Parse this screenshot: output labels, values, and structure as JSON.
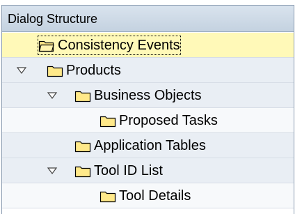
{
  "header": {
    "title": "Dialog Structure"
  },
  "tree": {
    "items": [
      {
        "label": "Consistency Events",
        "level": 1,
        "expandable": false,
        "selected": true
      },
      {
        "label": "Products",
        "level": 1,
        "expandable": true,
        "expanded": true
      },
      {
        "label": "Business Objects",
        "level": 2,
        "expandable": true,
        "expanded": true
      },
      {
        "label": "Proposed Tasks",
        "level": 3,
        "expandable": false
      },
      {
        "label": "Application Tables",
        "level": 2,
        "expandable": false
      },
      {
        "label": "Tool ID List",
        "level": 2,
        "expandable": true,
        "expanded": true
      },
      {
        "label": "Tool Details",
        "level": 3,
        "expandable": false
      }
    ]
  },
  "icons": {
    "folder": "folder-icon",
    "folder_open": "folder-open-icon",
    "expand_toggle": "triangle-down-icon"
  },
  "colors": {
    "header_bg": "#c4d2e0",
    "selected_row_bg": "#fff9b8",
    "folder_fill": "#ffe98a"
  }
}
